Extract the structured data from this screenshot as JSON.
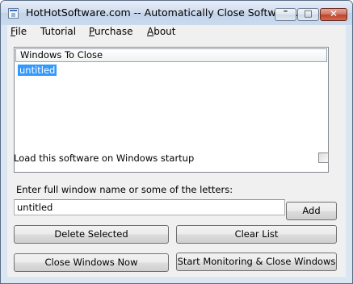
{
  "window": {
    "title": "HotHotSoftware.com -- Automatically Close Software ...",
    "controls": {
      "minimize": "–",
      "maximize": "□",
      "close": "✕"
    }
  },
  "menu": [
    {
      "underline": "F",
      "rest": "ile"
    },
    {
      "underline": "",
      "rest": "Tutorial"
    },
    {
      "underline": "P",
      "rest": "urchase"
    },
    {
      "underline": "A",
      "rest": "bout"
    }
  ],
  "list": {
    "header": "Windows To Close",
    "rows": [
      "untitled"
    ]
  },
  "startup": {
    "label": "Load this software on Windows startup",
    "checked": false
  },
  "entry": {
    "label": "Enter full window name or some of the letters:",
    "value": "untitled"
  },
  "buttons": {
    "add": "Add",
    "delete_selected": "Delete Selected",
    "clear_list": "Clear List",
    "close_windows_now": "Close Windows Now",
    "start_monitoring": "Start Monitoring & Close Windows"
  }
}
